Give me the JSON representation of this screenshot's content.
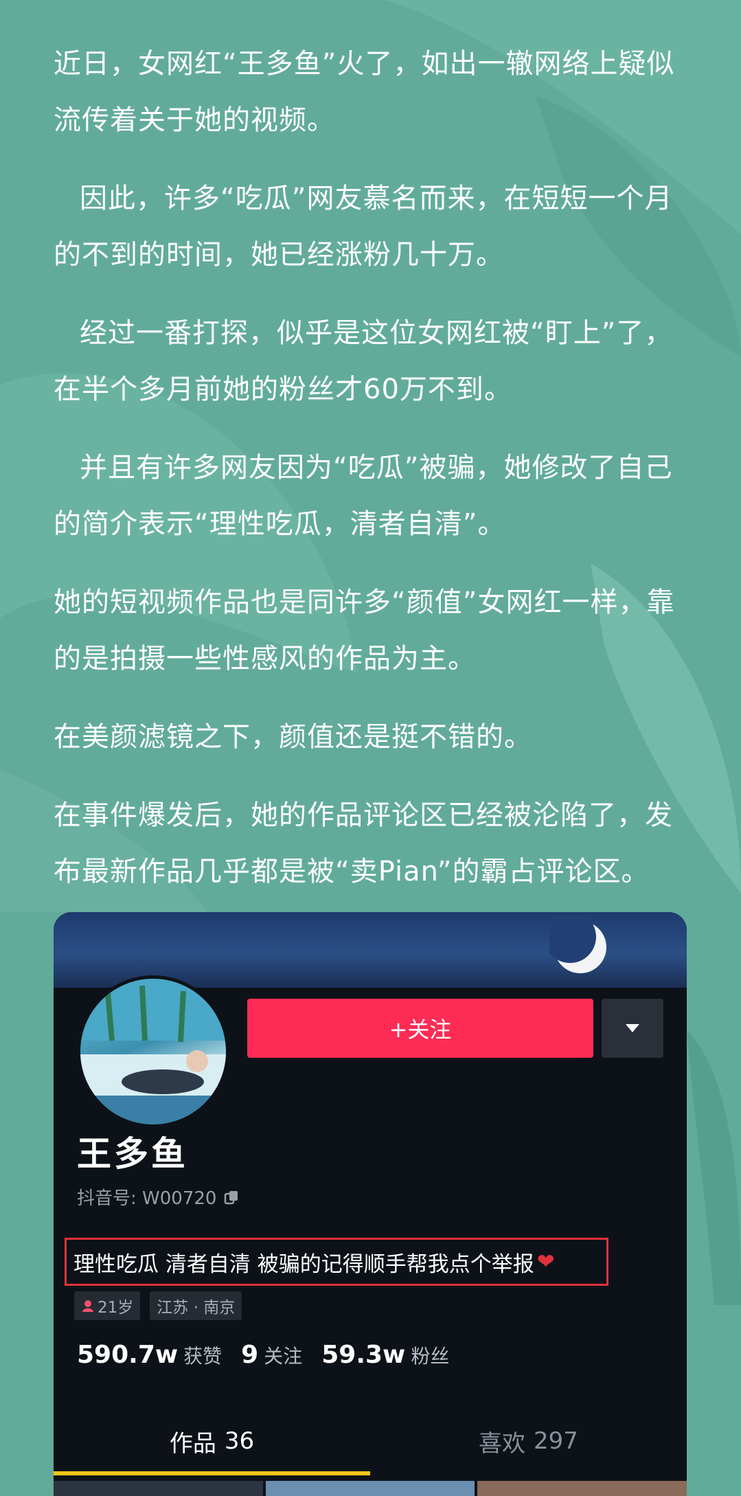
{
  "article": {
    "paragraphs": [
      {
        "text": "近日，女网红“王多鱼”火了，如出一辙网络上疑似流传着关于她的视频。",
        "indent": false
      },
      {
        "text": "因此，许多“吃瓜”网友慕名而来，在短短一个月的不到的时间，她已经涨粉几十万。",
        "indent": true
      },
      {
        "text": "经过一番打探，似乎是这位女网红被“盯上”了，在半个多月前她的粉丝才60万不到。",
        "indent": true
      },
      {
        "text": "并且有许多网友因为“吃瓜”被骗，她修改了自己的简介表示“理性吃瓜，清者自清”。",
        "indent": true
      },
      {
        "text": "她的短视频作品也是同许多“颜值”女网红一样，靠的是拍摄一些性感风的作品为主。",
        "indent": false
      },
      {
        "text": "在美颜滤镜之下，颜值还是挺不错的。",
        "indent": false
      },
      {
        "text": "在事件爆发后，她的作品评论区已经被沦陷了，发布最新作品几乎都是被“卖Pian”的霸占评论区。",
        "indent": false
      }
    ]
  },
  "profile": {
    "follow_label": "+关注",
    "more_icon": "caret-down-icon",
    "nickname": "王多鱼",
    "douyin_id": "抖音号: W00720",
    "copy_icon": "copy-icon",
    "bio": "理性吃瓜  清者自清  被骗的记得顺手帮我点个举报",
    "bio_heart": "❤",
    "tags": [
      {
        "icon": "female-icon",
        "label": "21岁"
      },
      {
        "icon": "",
        "label": "江苏 · 南京"
      }
    ],
    "stats": [
      {
        "value": "590.7w",
        "label": "获赞"
      },
      {
        "value": "9",
        "label": "关注"
      },
      {
        "value": "59.3w",
        "label": "粉丝"
      }
    ],
    "tabs": [
      {
        "label": "作品",
        "count": "36",
        "active": true
      },
      {
        "label": "喜欢",
        "count": "297",
        "active": false
      }
    ]
  },
  "colors": {
    "background": "#63ad9c",
    "follow": "#fe2c55",
    "bio_border": "#e0323c",
    "tab_underline": "#f5c518"
  }
}
